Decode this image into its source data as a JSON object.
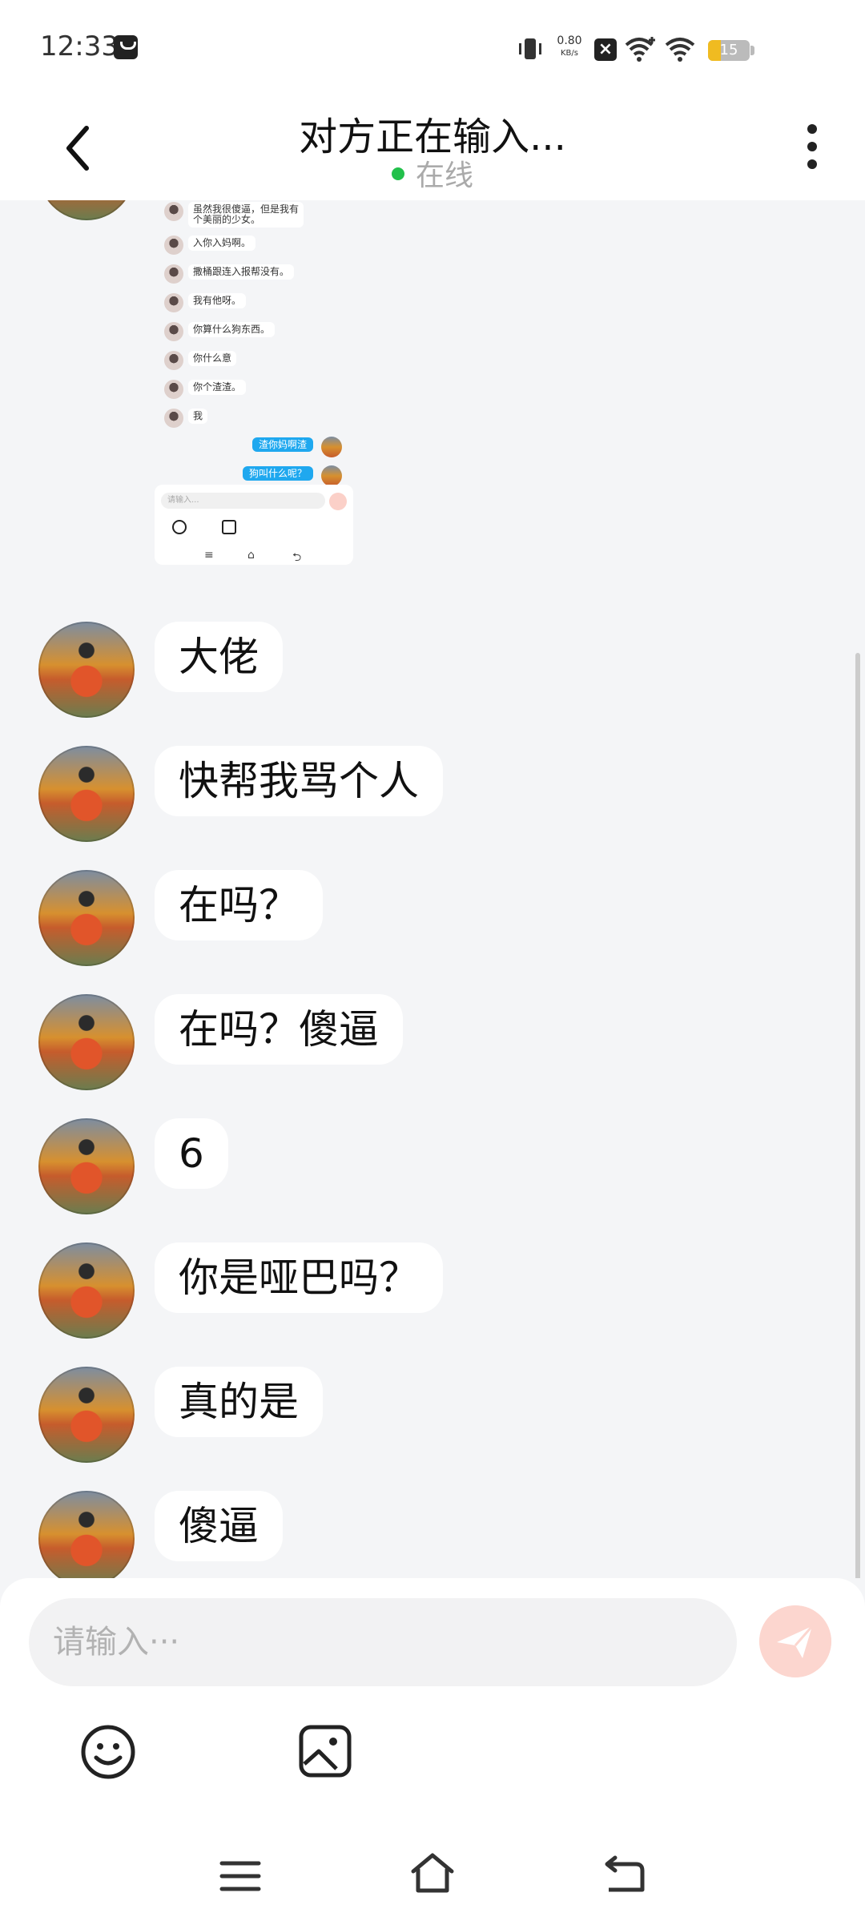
{
  "status_bar": {
    "time": "12:33",
    "net_speed_value": "0.80",
    "net_speed_unit": "KB/s",
    "battery_level": "15",
    "icons": [
      "bag-icon",
      "vibrate-icon",
      "close-box-icon",
      "wifi-plus-icon",
      "wifi-icon",
      "battery-icon"
    ]
  },
  "header": {
    "title": "对方正在输入...",
    "status": "在线",
    "status_color": "#22c04b"
  },
  "screenshot_preview": {
    "incoming": [
      "虽然我很傻逼，但是我有\n个美丽的少女。",
      "入你入妈啊。",
      "撒桶跟连入报帮没有。",
      "我有他呀。",
      "你算什么狗东西。",
      "你什么意",
      "你个渣渣。",
      "我"
    ],
    "outgoing": [
      "渣你妈啊渣",
      "狗叫什么呢？"
    ],
    "input_placeholder": "请输入..."
  },
  "messages": [
    {
      "text": "大佬"
    },
    {
      "text": "快帮我骂个人"
    },
    {
      "text": "在吗？"
    },
    {
      "text": "在吗？傻逼"
    },
    {
      "text": "6"
    },
    {
      "text": "你是哑巴吗？"
    },
    {
      "text": "真的是"
    },
    {
      "text": "傻逼"
    }
  ],
  "composer": {
    "placeholder": "请输入···",
    "send_color": "#fcd6cf"
  }
}
